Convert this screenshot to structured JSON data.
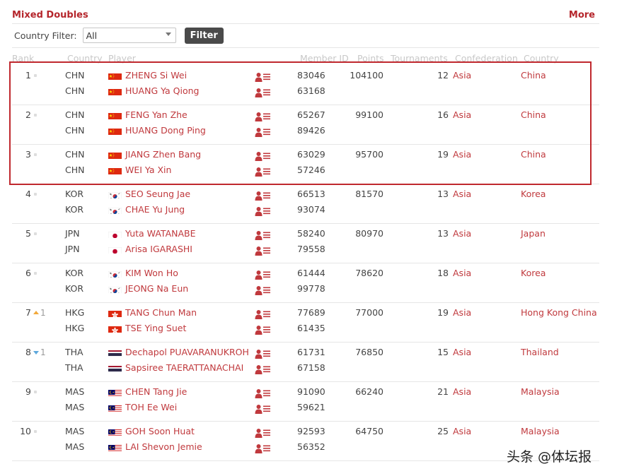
{
  "header": {
    "title": "Mixed Doubles",
    "more": "More"
  },
  "filter": {
    "label": "Country Filter:",
    "value": "All",
    "button": "Filter"
  },
  "columns": [
    "Rank",
    "Country",
    "Player",
    "Member ID",
    "Points",
    "Tournaments",
    "Confederation",
    "Country"
  ],
  "rows": [
    {
      "rank": "1",
      "move": "none",
      "move_num": "",
      "points": "104100",
      "tournaments": "12",
      "confederation": "Asia",
      "country": "China",
      "players": [
        {
          "cc": "CHN",
          "flag": "china",
          "name": "ZHENG Si Wei",
          "id": "83046"
        },
        {
          "cc": "CHN",
          "flag": "china",
          "name": "HUANG Ya Qiong",
          "id": "63168"
        }
      ]
    },
    {
      "rank": "2",
      "move": "none",
      "move_num": "",
      "points": "99100",
      "tournaments": "16",
      "confederation": "Asia",
      "country": "China",
      "players": [
        {
          "cc": "CHN",
          "flag": "china",
          "name": "FENG Yan Zhe",
          "id": "65267"
        },
        {
          "cc": "CHN",
          "flag": "china",
          "name": "HUANG Dong Ping",
          "id": "89426"
        }
      ]
    },
    {
      "rank": "3",
      "move": "none",
      "move_num": "",
      "points": "95700",
      "tournaments": "19",
      "confederation": "Asia",
      "country": "China",
      "players": [
        {
          "cc": "CHN",
          "flag": "china",
          "name": "JIANG Zhen Bang",
          "id": "63029"
        },
        {
          "cc": "CHN",
          "flag": "china",
          "name": "WEI Ya Xin",
          "id": "57246"
        }
      ]
    },
    {
      "rank": "4",
      "move": "none",
      "move_num": "",
      "points": "81570",
      "tournaments": "13",
      "confederation": "Asia",
      "country": "Korea",
      "players": [
        {
          "cc": "KOR",
          "flag": "korea",
          "name": "SEO Seung Jae",
          "id": "66513"
        },
        {
          "cc": "KOR",
          "flag": "korea",
          "name": "CHAE Yu Jung",
          "id": "93074"
        }
      ]
    },
    {
      "rank": "5",
      "move": "none",
      "move_num": "",
      "points": "80970",
      "tournaments": "13",
      "confederation": "Asia",
      "country": "Japan",
      "players": [
        {
          "cc": "JPN",
          "flag": "japan",
          "name": "Yuta WATANABE",
          "id": "58240"
        },
        {
          "cc": "JPN",
          "flag": "japan",
          "name": "Arisa IGARASHI",
          "id": "79558"
        }
      ]
    },
    {
      "rank": "6",
      "move": "none",
      "move_num": "",
      "points": "78620",
      "tournaments": "18",
      "confederation": "Asia",
      "country": "Korea",
      "players": [
        {
          "cc": "KOR",
          "flag": "korea",
          "name": "KIM Won Ho",
          "id": "61444"
        },
        {
          "cc": "KOR",
          "flag": "korea",
          "name": "JEONG Na Eun",
          "id": "99778"
        }
      ]
    },
    {
      "rank": "7",
      "move": "up",
      "move_num": "1",
      "points": "77000",
      "tournaments": "19",
      "confederation": "Asia",
      "country": "Hong Kong China",
      "players": [
        {
          "cc": "HKG",
          "flag": "hongkong",
          "name": "TANG Chun Man",
          "id": "77689"
        },
        {
          "cc": "HKG",
          "flag": "hongkong",
          "name": "TSE Ying Suet",
          "id": "61435"
        }
      ]
    },
    {
      "rank": "8",
      "move": "down",
      "move_num": "1",
      "points": "76850",
      "tournaments": "15",
      "confederation": "Asia",
      "country": "Thailand",
      "players": [
        {
          "cc": "THA",
          "flag": "thailand",
          "name": "Dechapol PUAVARANUKROH",
          "id": "61731"
        },
        {
          "cc": "THA",
          "flag": "thailand",
          "name": "Sapsiree TAERATTANACHAI",
          "id": "67158"
        }
      ]
    },
    {
      "rank": "9",
      "move": "none",
      "move_num": "",
      "points": "66240",
      "tournaments": "21",
      "confederation": "Asia",
      "country": "Malaysia",
      "players": [
        {
          "cc": "MAS",
          "flag": "malaysia",
          "name": "CHEN Tang Jie",
          "id": "91090"
        },
        {
          "cc": "MAS",
          "flag": "malaysia",
          "name": "TOH Ee Wei",
          "id": "59621"
        }
      ]
    },
    {
      "rank": "10",
      "move": "none",
      "move_num": "",
      "points": "64750",
      "tournaments": "25",
      "confederation": "Asia",
      "country": "Malaysia",
      "players": [
        {
          "cc": "MAS",
          "flag": "malaysia",
          "name": "GOH Soon Huat",
          "id": "92593"
        },
        {
          "cc": "MAS",
          "flag": "malaysia",
          "name": "LAI Shevon Jemie",
          "id": "56352"
        }
      ]
    }
  ],
  "watermark": "头条 @体坛报",
  "colors": {
    "accent": "#c0393d",
    "highlight_border": "#c0282e",
    "filter_button": "#4a4a4a",
    "rank_up": "#f2a93b",
    "rank_down": "#5ea8dc"
  }
}
